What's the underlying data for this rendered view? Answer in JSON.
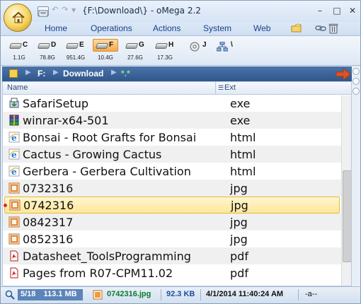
{
  "window": {
    "title": "{F:\\Download\\} - oMega 2.2",
    "minimize_glyph": "–",
    "maximize_glyph": "□",
    "close_glyph": "✕"
  },
  "ribbon": {
    "tabs": [
      {
        "label": "Home"
      },
      {
        "label": "Operations"
      },
      {
        "label": "Actions"
      },
      {
        "label": "System"
      },
      {
        "label": "Web"
      }
    ]
  },
  "drives": [
    {
      "letter": "C",
      "size": "1.1G",
      "active": false
    },
    {
      "letter": "D",
      "size": "78.8G",
      "active": false
    },
    {
      "letter": "E",
      "size": "951.4G",
      "active": false
    },
    {
      "letter": "F",
      "size": "10.4G",
      "active": true
    },
    {
      "letter": "G",
      "size": "27.6G",
      "active": false
    },
    {
      "letter": "H",
      "size": "17.3G",
      "active": false
    },
    {
      "letter": "J",
      "size": "",
      "active": false
    },
    {
      "letter": "\\",
      "size": "",
      "active": false
    }
  ],
  "address": {
    "root": "F:",
    "folder": "Download",
    "filter": "*.*"
  },
  "columns": {
    "name": "Name",
    "ext": "Ext"
  },
  "files": [
    {
      "name": "SafariSetup",
      "ext": "exe",
      "icon": "installer-icon"
    },
    {
      "name": "winrar-x64-501",
      "ext": "exe",
      "icon": "winrar-icon"
    },
    {
      "name": "Bonsai - Root Grafts for Bonsai",
      "ext": "html",
      "icon": "ie-icon"
    },
    {
      "name": "Cactus - Growing Cactus",
      "ext": "html",
      "icon": "ie-icon"
    },
    {
      "name": "Gerbera - Gerbera Cultivation",
      "ext": "html",
      "icon": "ie-icon"
    },
    {
      "name": "0732316",
      "ext": "jpg",
      "icon": "image-icon"
    },
    {
      "name": "0742316",
      "ext": "jpg",
      "icon": "image-icon",
      "selected": true
    },
    {
      "name": "0842317",
      "ext": "jpg",
      "icon": "image-icon"
    },
    {
      "name": "0852316",
      "ext": "jpg",
      "icon": "image-icon"
    },
    {
      "name": "Datasheet_ToolsProgramming",
      "ext": "pdf",
      "icon": "pdf-icon"
    },
    {
      "name": "Pages from R07-CPM11.02",
      "ext": "pdf",
      "icon": "pdf-icon"
    }
  ],
  "status": {
    "count": "5/18",
    "total": "113.1 MB",
    "current_file": "0742316.jpg",
    "file_size": "92.3 KB",
    "datetime": "4/1/2014 11:40:24 AM",
    "attributes": "-a--"
  },
  "colors": {
    "accent": "#15428b",
    "address_bar": "#2f568b",
    "selection": "#fde79a",
    "active_drive": "#f6a94a",
    "status_file": "#0a7a2c",
    "status_size": "#1b4fa0"
  }
}
